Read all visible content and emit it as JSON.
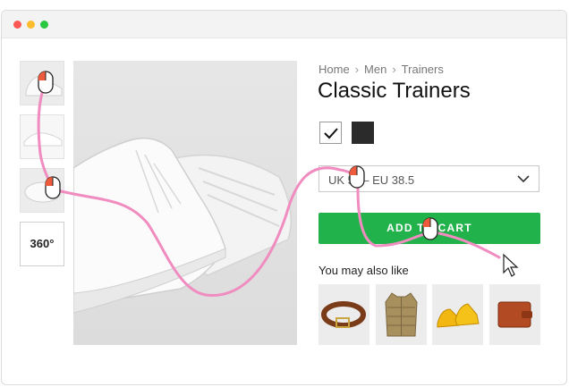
{
  "window": {
    "dots": [
      "close",
      "minimize",
      "maximize"
    ]
  },
  "colors": {
    "accent": "#22b24c",
    "path": "#f08cc0",
    "mouse_button": "#ee5a3c"
  },
  "gallery": {
    "thumb_360_label": "360°"
  },
  "breadcrumb": {
    "items": [
      "Home",
      "Men",
      "Trainers"
    ]
  },
  "product": {
    "title": "Classic Trainers",
    "colors": [
      {
        "name": "white",
        "selected": true
      },
      {
        "name": "black",
        "selected": false
      }
    ],
    "size_selected": "UK 5 — EU 38.5",
    "add_to_cart_label": "ADD TO CART"
  },
  "recommendations": {
    "heading": "You may also like",
    "items": [
      {
        "icon": "belt-icon"
      },
      {
        "icon": "gilet-icon"
      },
      {
        "icon": "yellow-shoes-icon"
      },
      {
        "icon": "wallet-icon"
      }
    ]
  }
}
